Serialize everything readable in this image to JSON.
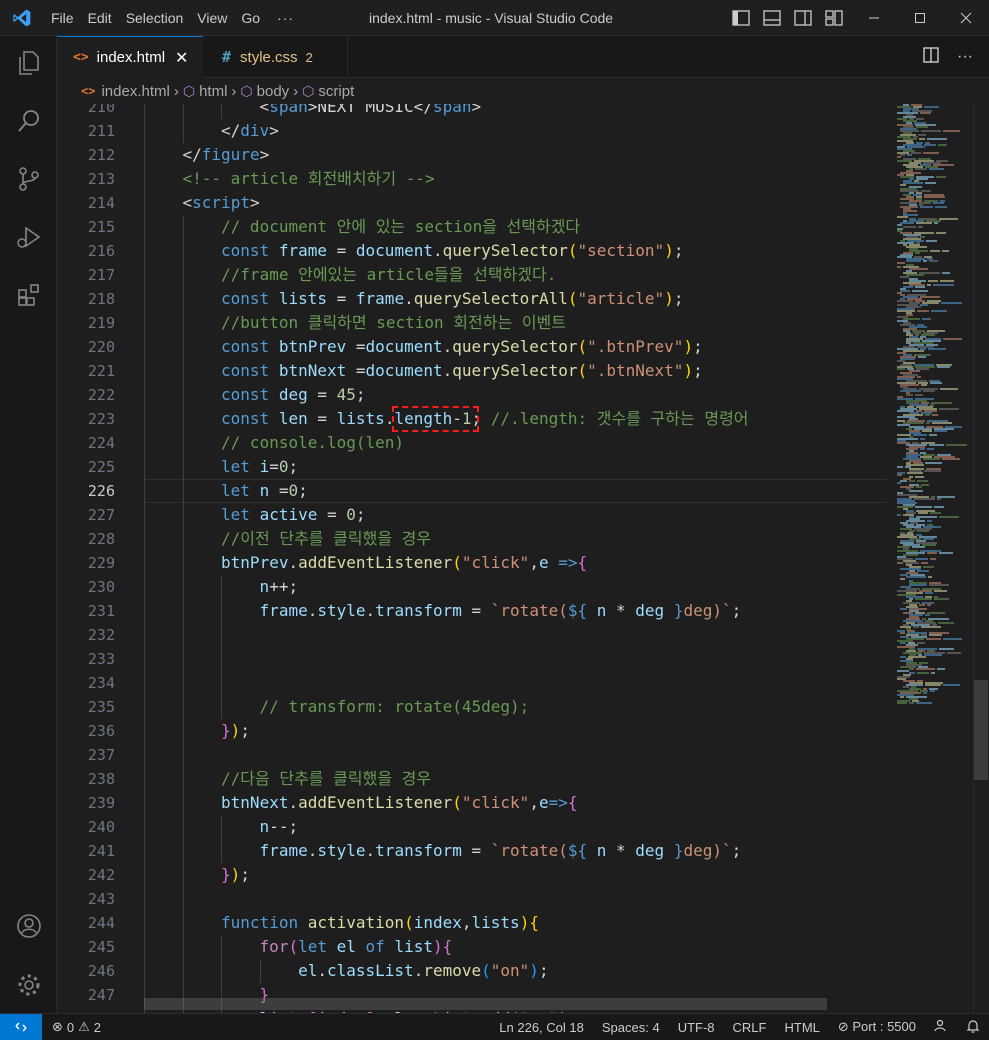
{
  "window": {
    "title": "index.html - music - Visual Studio Code",
    "menu": [
      "File",
      "Edit",
      "Selection",
      "View",
      "Go"
    ],
    "menu_more": "···"
  },
  "tabs": [
    {
      "label": "index.html",
      "icon": "html-file-icon",
      "active": true
    },
    {
      "label": "style.css",
      "icon": "css-file-icon",
      "badge": "2",
      "active": false
    }
  ],
  "breadcrumb": [
    "index.html",
    "html",
    "body",
    "script"
  ],
  "editor": {
    "current_line": 226,
    "highlighted_text": "length-1",
    "lines": [
      {
        "n": 210,
        "indent": 3,
        "tokens": [
          [
            "<",
            ""
          ],
          [
            "span",
            "t-tag"
          ],
          [
            ">NEXT MUSIC</",
            "t-text"
          ],
          [
            "span",
            "t-tag"
          ],
          [
            ">",
            "t-text"
          ]
        ]
      },
      {
        "n": 211,
        "indent": 2,
        "tokens": [
          [
            "</",
            ""
          ],
          [
            "div",
            "t-tag"
          ],
          [
            ">",
            ""
          ]
        ]
      },
      {
        "n": 212,
        "indent": 1,
        "tokens": [
          [
            "</",
            ""
          ],
          [
            "figure",
            "t-tag"
          ],
          [
            ">",
            ""
          ]
        ]
      },
      {
        "n": 213,
        "indent": 1,
        "tokens": [
          [
            "<!-- article 회전배치하기 -->",
            "t-comment"
          ]
        ]
      },
      {
        "n": 214,
        "indent": 1,
        "tokens": [
          [
            "<",
            ""
          ],
          [
            "script",
            "t-tag"
          ],
          [
            ">",
            ""
          ]
        ]
      },
      {
        "n": 215,
        "indent": 2,
        "tokens": [
          [
            "// document 안에 있는 section을 선택하겠다",
            "t-comment"
          ]
        ]
      },
      {
        "n": 216,
        "indent": 2,
        "tokens": [
          [
            "const ",
            "t-kw"
          ],
          [
            "frame",
            "t-var"
          ],
          [
            " = ",
            ""
          ],
          [
            "document",
            "t-var"
          ],
          [
            ".",
            ""
          ],
          [
            "querySelector",
            "t-fn"
          ],
          [
            "(",
            "t-br1"
          ],
          [
            "\"section\"",
            "t-str"
          ],
          [
            ")",
            "t-br1"
          ],
          [
            ";",
            ""
          ]
        ]
      },
      {
        "n": 217,
        "indent": 2,
        "tokens": [
          [
            "//frame 안에있는 article들을 선택하겠다.",
            "t-comment"
          ]
        ]
      },
      {
        "n": 218,
        "indent": 2,
        "tokens": [
          [
            "const ",
            "t-kw"
          ],
          [
            "lists",
            "t-var"
          ],
          [
            " = ",
            ""
          ],
          [
            "frame",
            "t-var"
          ],
          [
            ".",
            ""
          ],
          [
            "querySelectorAll",
            "t-fn"
          ],
          [
            "(",
            "t-br1"
          ],
          [
            "\"article\"",
            "t-str"
          ],
          [
            ")",
            "t-br1"
          ],
          [
            ";",
            ""
          ]
        ]
      },
      {
        "n": 219,
        "indent": 2,
        "tokens": [
          [
            "//button 클릭하면 section 회전하는 이벤트",
            "t-comment"
          ]
        ]
      },
      {
        "n": 220,
        "indent": 2,
        "tokens": [
          [
            "const ",
            "t-kw"
          ],
          [
            "btnPrev",
            "t-var"
          ],
          [
            " =",
            ""
          ],
          [
            "document",
            "t-var"
          ],
          [
            ".",
            ""
          ],
          [
            "querySelector",
            "t-fn"
          ],
          [
            "(",
            "t-br1"
          ],
          [
            "\".btnPrev\"",
            "t-str"
          ],
          [
            ")",
            "t-br1"
          ],
          [
            ";",
            ""
          ]
        ]
      },
      {
        "n": 221,
        "indent": 2,
        "tokens": [
          [
            "const ",
            "t-kw"
          ],
          [
            "btnNext",
            "t-var"
          ],
          [
            " =",
            ""
          ],
          [
            "document",
            "t-var"
          ],
          [
            ".",
            ""
          ],
          [
            "querySelector",
            "t-fn"
          ],
          [
            "(",
            "t-br1"
          ],
          [
            "\".btnNext\"",
            "t-str"
          ],
          [
            ")",
            "t-br1"
          ],
          [
            ";",
            ""
          ]
        ]
      },
      {
        "n": 222,
        "indent": 2,
        "tokens": [
          [
            "const ",
            "t-kw"
          ],
          [
            "deg",
            "t-var"
          ],
          [
            " = ",
            ""
          ],
          [
            "45",
            "t-num"
          ],
          [
            ";",
            ""
          ]
        ]
      },
      {
        "n": 223,
        "indent": 2,
        "tokens": [
          [
            "const ",
            "t-kw"
          ],
          [
            "len",
            "t-var"
          ],
          [
            " = ",
            ""
          ],
          [
            "lists",
            "t-var"
          ],
          [
            ".",
            ""
          ],
          [
            "length",
            "t-var"
          ],
          [
            "-",
            ""
          ],
          [
            "1",
            "t-num"
          ],
          [
            "; ",
            ""
          ],
          [
            "//.length: 갯수를 구하는 명령어",
            "t-comment"
          ]
        ]
      },
      {
        "n": 224,
        "indent": 2,
        "tokens": [
          [
            "// console.log(len)",
            "t-comment"
          ]
        ]
      },
      {
        "n": 225,
        "indent": 2,
        "tokens": [
          [
            "let ",
            "t-kw"
          ],
          [
            "i",
            "t-var"
          ],
          [
            "=",
            ""
          ],
          [
            "0",
            "t-num"
          ],
          [
            ";",
            ""
          ]
        ]
      },
      {
        "n": 226,
        "indent": 2,
        "tokens": [
          [
            "let ",
            "t-kw"
          ],
          [
            "n",
            "t-var"
          ],
          [
            " =",
            ""
          ],
          [
            "0",
            "t-num"
          ],
          [
            ";",
            ""
          ]
        ]
      },
      {
        "n": 227,
        "indent": 2,
        "tokens": [
          [
            "let ",
            "t-kw"
          ],
          [
            "active",
            "t-var"
          ],
          [
            " = ",
            ""
          ],
          [
            "0",
            "t-num"
          ],
          [
            ";",
            ""
          ]
        ]
      },
      {
        "n": 228,
        "indent": 2,
        "tokens": [
          [
            "//이전 단추를 클릭했을 경우",
            "t-comment"
          ]
        ]
      },
      {
        "n": 229,
        "indent": 2,
        "tokens": [
          [
            "btnPrev",
            "t-var"
          ],
          [
            ".",
            ""
          ],
          [
            "addEventListener",
            "t-fn"
          ],
          [
            "(",
            "t-br1"
          ],
          [
            "\"click\"",
            "t-str"
          ],
          [
            ",",
            ""
          ],
          [
            "e",
            "t-var"
          ],
          [
            " =>",
            "t-kw"
          ],
          [
            "{",
            "t-br2"
          ]
        ]
      },
      {
        "n": 230,
        "indent": 3,
        "tokens": [
          [
            "n",
            "t-var"
          ],
          [
            "++;",
            ""
          ]
        ]
      },
      {
        "n": 231,
        "indent": 3,
        "tokens": [
          [
            "frame",
            "t-var"
          ],
          [
            ".",
            ""
          ],
          [
            "style",
            "t-var"
          ],
          [
            ".",
            ""
          ],
          [
            "transform",
            "t-var"
          ],
          [
            " = ",
            ""
          ],
          [
            "`rotate(",
            "t-str"
          ],
          [
            "${",
            "t-kw"
          ],
          [
            " n ",
            "t-var"
          ],
          [
            "* ",
            ""
          ],
          [
            "deg",
            "t-var"
          ],
          [
            " }",
            "t-kw"
          ],
          [
            "deg)`",
            "t-str"
          ],
          [
            ";",
            ""
          ]
        ]
      },
      {
        "n": 232,
        "indent": 3,
        "tokens": []
      },
      {
        "n": 233,
        "indent": 3,
        "tokens": []
      },
      {
        "n": 234,
        "indent": 3,
        "tokens": []
      },
      {
        "n": 235,
        "indent": 3,
        "tokens": [
          [
            "// transform: rotate(45deg);",
            "t-comment"
          ]
        ]
      },
      {
        "n": 236,
        "indent": 2,
        "tokens": [
          [
            "}",
            "t-br2"
          ],
          [
            ")",
            "t-br1"
          ],
          [
            ";",
            ""
          ]
        ]
      },
      {
        "n": 237,
        "indent": 2,
        "tokens": []
      },
      {
        "n": 238,
        "indent": 2,
        "tokens": [
          [
            "//다음 단추를 클릭했을 경우",
            "t-comment"
          ]
        ]
      },
      {
        "n": 239,
        "indent": 2,
        "tokens": [
          [
            "btnNext",
            "t-var"
          ],
          [
            ".",
            ""
          ],
          [
            "addEventListener",
            "t-fn"
          ],
          [
            "(",
            "t-br1"
          ],
          [
            "\"click\"",
            "t-str"
          ],
          [
            ",",
            ""
          ],
          [
            "e",
            "t-var"
          ],
          [
            "=>",
            "t-kw"
          ],
          [
            "{",
            "t-br2"
          ]
        ]
      },
      {
        "n": 240,
        "indent": 3,
        "tokens": [
          [
            "n",
            "t-var"
          ],
          [
            "--;",
            ""
          ]
        ]
      },
      {
        "n": 241,
        "indent": 3,
        "tokens": [
          [
            "frame",
            "t-var"
          ],
          [
            ".",
            ""
          ],
          [
            "style",
            "t-var"
          ],
          [
            ".",
            ""
          ],
          [
            "transform",
            "t-var"
          ],
          [
            " = ",
            ""
          ],
          [
            "`rotate(",
            "t-str"
          ],
          [
            "${",
            "t-kw"
          ],
          [
            " n ",
            "t-var"
          ],
          [
            "* ",
            ""
          ],
          [
            "deg",
            "t-var"
          ],
          [
            " }",
            "t-kw"
          ],
          [
            "deg)`",
            "t-str"
          ],
          [
            ";",
            ""
          ]
        ]
      },
      {
        "n": 242,
        "indent": 2,
        "tokens": [
          [
            "}",
            "t-br2"
          ],
          [
            ")",
            "t-br1"
          ],
          [
            ";",
            ""
          ]
        ]
      },
      {
        "n": 243,
        "indent": 2,
        "tokens": []
      },
      {
        "n": 244,
        "indent": 2,
        "tokens": [
          [
            "function ",
            "t-kw"
          ],
          [
            "activation",
            "t-fn"
          ],
          [
            "(",
            "t-br1"
          ],
          [
            "index",
            "t-var"
          ],
          [
            ",",
            ""
          ],
          [
            "lists",
            "t-var"
          ],
          [
            ")",
            "t-br1"
          ],
          [
            "{",
            "t-br1"
          ]
        ]
      },
      {
        "n": 245,
        "indent": 3,
        "tokens": [
          [
            "for",
            "t-ctrl"
          ],
          [
            "(",
            "t-br2"
          ],
          [
            "let ",
            "t-kw"
          ],
          [
            "el ",
            "t-var"
          ],
          [
            "of ",
            "t-kw"
          ],
          [
            "list",
            "t-var"
          ],
          [
            ")",
            "t-br2"
          ],
          [
            "{",
            "t-br2"
          ]
        ]
      },
      {
        "n": 246,
        "indent": 4,
        "tokens": [
          [
            "el",
            "t-var"
          ],
          [
            ".",
            ""
          ],
          [
            "classList",
            "t-var"
          ],
          [
            ".",
            ""
          ],
          [
            "remove",
            "t-fn"
          ],
          [
            "(",
            "t-br3"
          ],
          [
            "\"on\"",
            "t-str"
          ],
          [
            ")",
            "t-br3"
          ],
          [
            ";",
            ""
          ]
        ]
      },
      {
        "n": 247,
        "indent": 3,
        "tokens": [
          [
            "}",
            "t-br2"
          ]
        ]
      },
      {
        "n": 248,
        "indent": 3,
        "tokens": [
          [
            "lists",
            "t-var"
          ],
          [
            "[",
            "t-br2"
          ],
          [
            "index",
            "t-var"
          ],
          [
            "]",
            "t-br2"
          ],
          [
            ".",
            ""
          ],
          [
            "classList",
            "t-var"
          ],
          [
            ".",
            ""
          ],
          [
            "add",
            "t-fn"
          ],
          [
            "(",
            "t-br2"
          ],
          [
            "\"on\"",
            "t-str"
          ],
          [
            ")",
            "t-br2"
          ],
          [
            ";",
            ""
          ]
        ]
      }
    ]
  },
  "status": {
    "errors": "0",
    "warnings": "2",
    "position": "Ln 226, Col 18",
    "spaces": "Spaces: 4",
    "encoding": "UTF-8",
    "eol": "CRLF",
    "language": "HTML",
    "port": "Port : 5500"
  },
  "colors": {
    "accent": "#0078d4",
    "highlight_box": "#ff1a1a"
  }
}
